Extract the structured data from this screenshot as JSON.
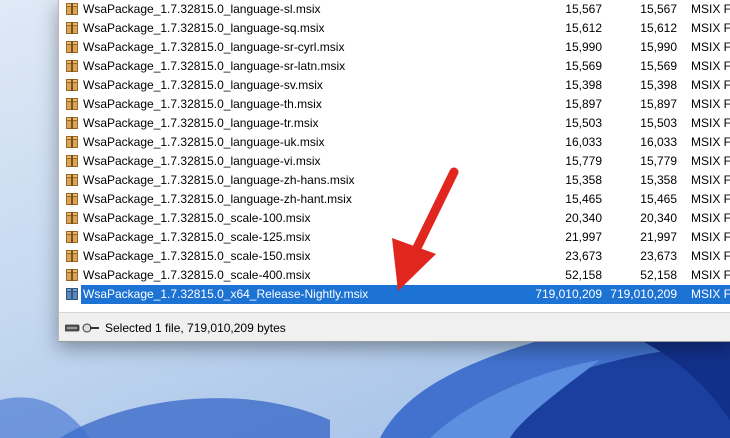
{
  "files": [
    {
      "name": "WsaPackage_1.7.32815.0_language-sl.msix",
      "size": "15,567",
      "packed": "15,567",
      "type": "MSIX Fi"
    },
    {
      "name": "WsaPackage_1.7.32815.0_language-sq.msix",
      "size": "15,612",
      "packed": "15,612",
      "type": "MSIX Fi"
    },
    {
      "name": "WsaPackage_1.7.32815.0_language-sr-cyrl.msix",
      "size": "15,990",
      "packed": "15,990",
      "type": "MSIX Fi"
    },
    {
      "name": "WsaPackage_1.7.32815.0_language-sr-latn.msix",
      "size": "15,569",
      "packed": "15,569",
      "type": "MSIX Fi"
    },
    {
      "name": "WsaPackage_1.7.32815.0_language-sv.msix",
      "size": "15,398",
      "packed": "15,398",
      "type": "MSIX Fi"
    },
    {
      "name": "WsaPackage_1.7.32815.0_language-th.msix",
      "size": "15,897",
      "packed": "15,897",
      "type": "MSIX Fi"
    },
    {
      "name": "WsaPackage_1.7.32815.0_language-tr.msix",
      "size": "15,503",
      "packed": "15,503",
      "type": "MSIX Fi"
    },
    {
      "name": "WsaPackage_1.7.32815.0_language-uk.msix",
      "size": "16,033",
      "packed": "16,033",
      "type": "MSIX Fi"
    },
    {
      "name": "WsaPackage_1.7.32815.0_language-vi.msix",
      "size": "15,779",
      "packed": "15,779",
      "type": "MSIX Fi"
    },
    {
      "name": "WsaPackage_1.7.32815.0_language-zh-hans.msix",
      "size": "15,358",
      "packed": "15,358",
      "type": "MSIX Fi"
    },
    {
      "name": "WsaPackage_1.7.32815.0_language-zh-hant.msix",
      "size": "15,465",
      "packed": "15,465",
      "type": "MSIX Fi"
    },
    {
      "name": "WsaPackage_1.7.32815.0_scale-100.msix",
      "size": "20,340",
      "packed": "20,340",
      "type": "MSIX Fi"
    },
    {
      "name": "WsaPackage_1.7.32815.0_scale-125.msix",
      "size": "21,997",
      "packed": "21,997",
      "type": "MSIX Fi"
    },
    {
      "name": "WsaPackage_1.7.32815.0_scale-150.msix",
      "size": "23,673",
      "packed": "23,673",
      "type": "MSIX Fi"
    },
    {
      "name": "WsaPackage_1.7.32815.0_scale-400.msix",
      "size": "52,158",
      "packed": "52,158",
      "type": "MSIX Fi"
    },
    {
      "name": "WsaPackage_1.7.32815.0_x64_Release-Nightly.msix",
      "size": "719,010,209",
      "packed": "719,010,209",
      "type": "MSIX Fi",
      "selected": true
    }
  ],
  "status": {
    "text": "Selected 1 file, 719,010,209 bytes",
    "icon": "drive-key-icon"
  },
  "colors": {
    "selection": "#1c73d4",
    "arrow": "#e0261e"
  }
}
